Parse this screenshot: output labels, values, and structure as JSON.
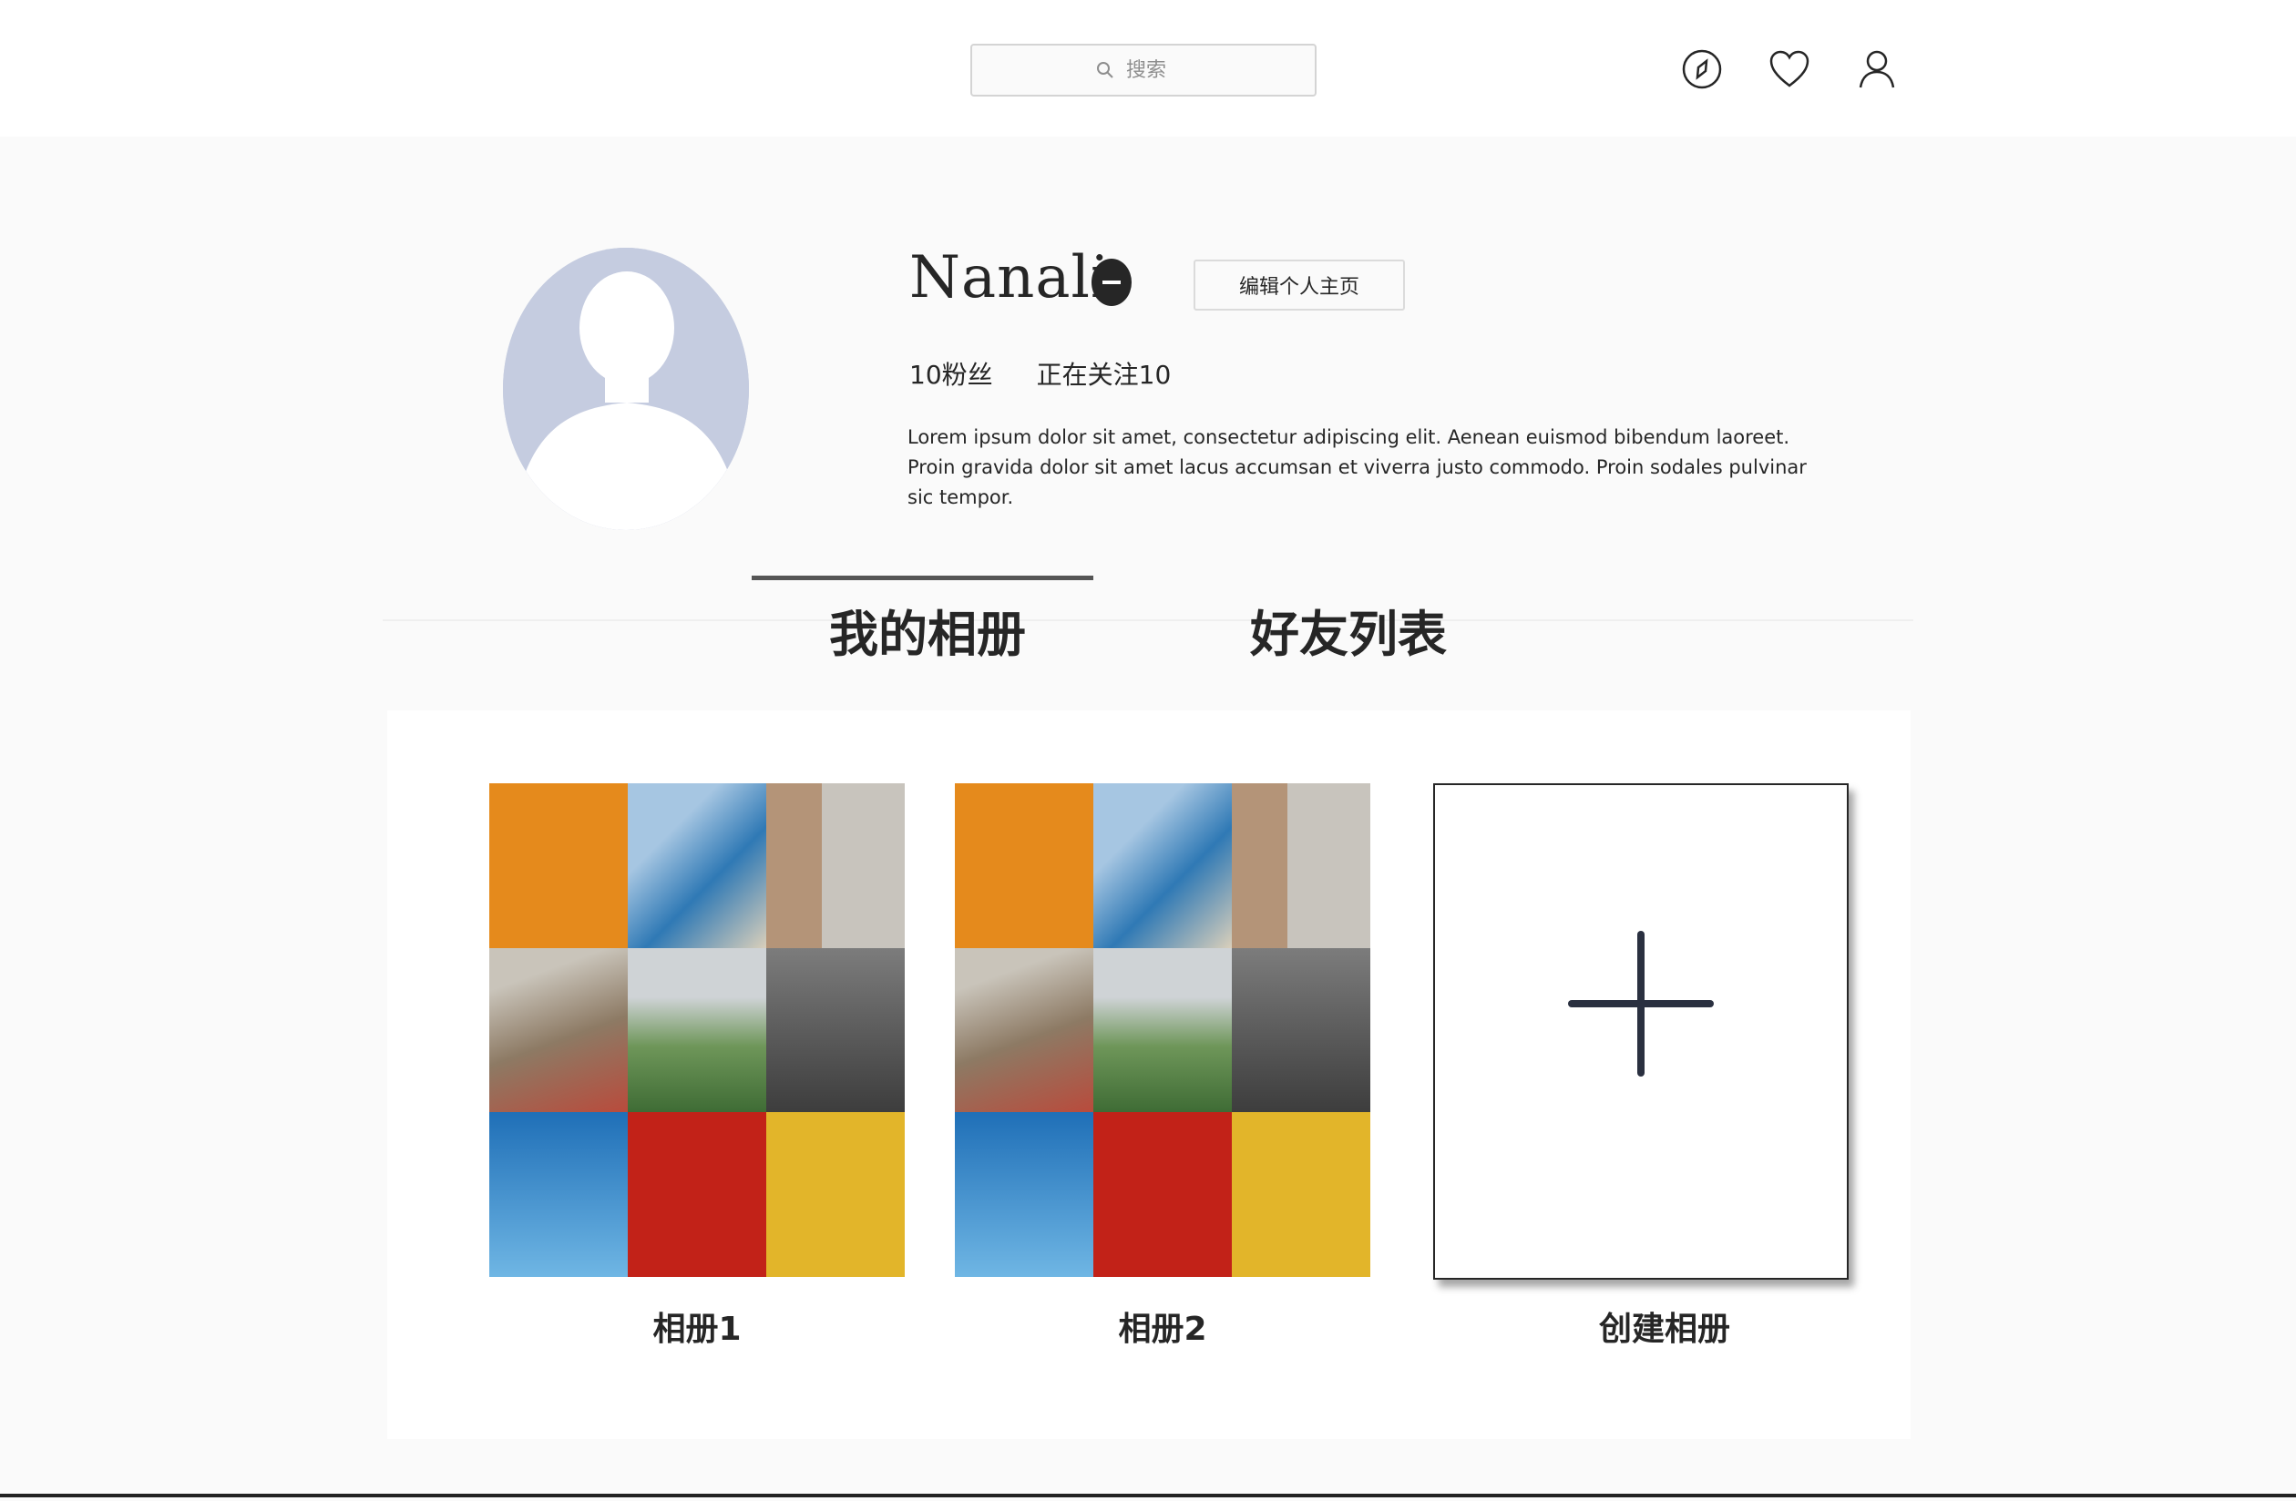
{
  "header": {
    "search_placeholder": "搜索",
    "icons": [
      "compass-icon",
      "heart-icon",
      "user-icon"
    ]
  },
  "profile": {
    "username": "Nanali",
    "edit_button": "编辑个人主页",
    "followers": "10粉丝",
    "following": "正在关注10",
    "bio": "Lorem ipsum dolor sit amet, consectetur adipiscing elit. Aenean euismod bibendum laoreet. Proin gravida dolor sit amet lacus accumsan et viverra justo commodo. Proin sodales pulvinar sic tempor."
  },
  "tabs": {
    "albums": "我的相册",
    "friends": "好友列表"
  },
  "albums": [
    {
      "label": "相册1"
    },
    {
      "label": "相册2"
    }
  ],
  "create_album": {
    "label": "创建相册"
  },
  "colors": {
    "tiles": [
      "#e58a1c",
      "#3f86b8",
      "#b9b2a6",
      "#a89a86",
      "#7fa46b",
      "#5a5a5a",
      "#3a86c6",
      "#c22218",
      "#e2b52a"
    ],
    "avatar_bg": "#c5cce0"
  }
}
